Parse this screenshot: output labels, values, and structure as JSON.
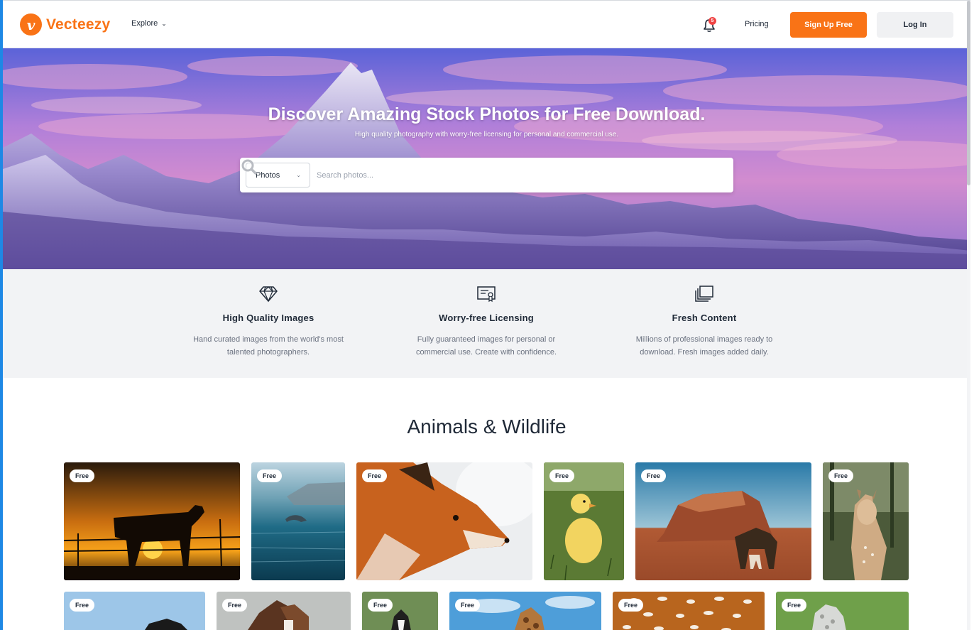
{
  "header": {
    "logo_text": "Vecteezy",
    "logo_letter": "v",
    "explore_label": "Explore",
    "notification_count": "5",
    "pricing_label": "Pricing",
    "signup_label": "Sign Up Free",
    "login_label": "Log In"
  },
  "hero": {
    "title": "Discover Amazing Stock Photos for Free Download.",
    "subtitle": "High quality photography with worry-free licensing for personal and commercial use.",
    "search": {
      "category": "Photos",
      "placeholder": "Search photos..."
    }
  },
  "features": [
    {
      "icon": "diamond-icon",
      "title": "High Quality Images",
      "desc": "Hand curated images from the world's most talented photographers."
    },
    {
      "icon": "certificate-icon",
      "title": "Worry-free Licensing",
      "desc": "Fully guaranteed images for personal or commercial use. Create with confidence."
    },
    {
      "icon": "stacked-images-icon",
      "title": "Fresh Content",
      "desc": "Millions of professional images ready to download. Fresh images added daily."
    }
  ],
  "section": {
    "title": "Animals & Wildlife",
    "badge": "Free"
  },
  "colors": {
    "brand": "#f97316",
    "hero_purple": "#8b6fd3",
    "feature_bg": "#f2f3f5"
  }
}
